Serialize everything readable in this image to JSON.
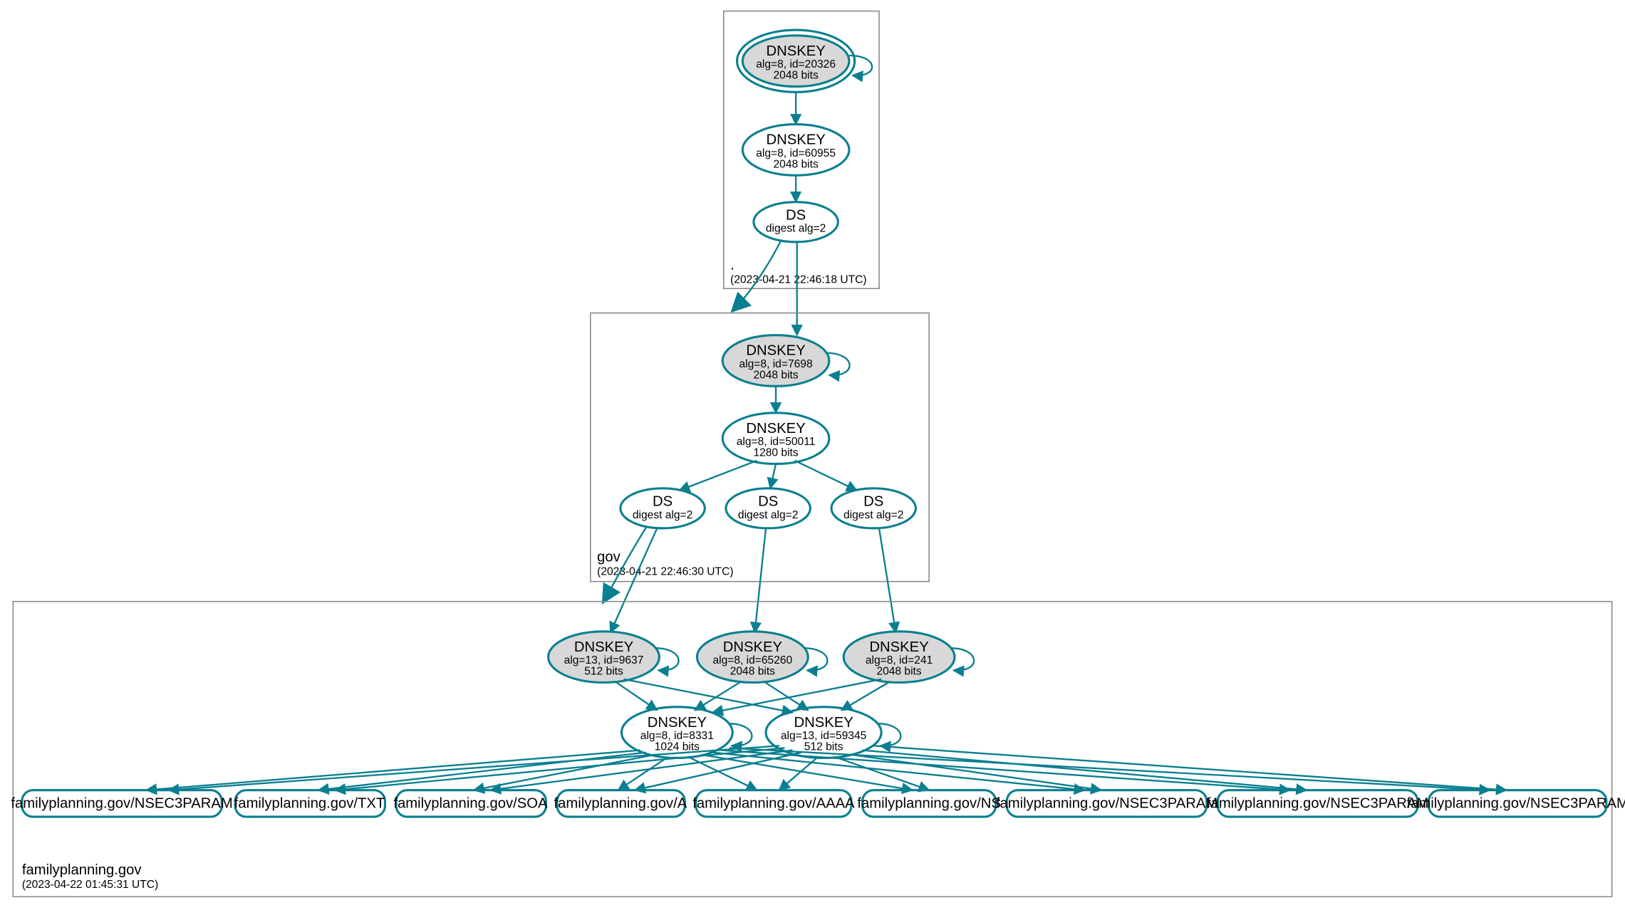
{
  "colors": {
    "stroke": "#0a7f8f",
    "ksk_fill": "#d8d8d8"
  },
  "zones": [
    {
      "id": "root",
      "label": ".",
      "timestamp": "(2023-04-21 22:46:18 UTC)"
    },
    {
      "id": "gov",
      "label": "gov",
      "timestamp": "(2023-04-21 22:46:30 UTC)"
    },
    {
      "id": "familyplanning",
      "label": "familyplanning.gov",
      "timestamp": "(2023-04-22 01:45:31 UTC)"
    }
  ],
  "nodes": {
    "root_ksk": {
      "t1": "DNSKEY",
      "t2": "alg=8, id=20326",
      "t3": "2048 bits"
    },
    "root_zsk": {
      "t1": "DNSKEY",
      "t2": "alg=8, id=60955",
      "t3": "2048 bits"
    },
    "root_ds": {
      "t1": "DS",
      "t2": "digest alg=2"
    },
    "gov_ksk": {
      "t1": "DNSKEY",
      "t2": "alg=8, id=7698",
      "t3": "2048 bits"
    },
    "gov_zsk": {
      "t1": "DNSKEY",
      "t2": "alg=8, id=50011",
      "t3": "1280 bits"
    },
    "gov_ds1": {
      "t1": "DS",
      "t2": "digest alg=2"
    },
    "gov_ds2": {
      "t1": "DS",
      "t2": "digest alg=2"
    },
    "gov_ds3": {
      "t1": "DS",
      "t2": "digest alg=2"
    },
    "fp_ksk1": {
      "t1": "DNSKEY",
      "t2": "alg=13, id=9637",
      "t3": "512 bits"
    },
    "fp_ksk2": {
      "t1": "DNSKEY",
      "t2": "alg=8, id=65260",
      "t3": "2048 bits"
    },
    "fp_ksk3": {
      "t1": "DNSKEY",
      "t2": "alg=8, id=241",
      "t3": "2048 bits"
    },
    "fp_zsk1": {
      "t1": "DNSKEY",
      "t2": "alg=8, id=8331",
      "t3": "1024 bits"
    },
    "fp_zsk2": {
      "t1": "DNSKEY",
      "t2": "alg=13, id=59345",
      "t3": "512 bits"
    },
    "rr1": {
      "t1": "familyplanning.gov/NSEC3PARAM"
    },
    "rr2": {
      "t1": "familyplanning.gov/TXT"
    },
    "rr3": {
      "t1": "familyplanning.gov/SOA"
    },
    "rr4": {
      "t1": "familyplanning.gov/A"
    },
    "rr5": {
      "t1": "familyplanning.gov/AAAA"
    },
    "rr6": {
      "t1": "familyplanning.gov/NS"
    },
    "rr7": {
      "t1": "familyplanning.gov/NSEC3PARAM"
    },
    "rr8": {
      "t1": "familyplanning.gov/NSEC3PARAM"
    },
    "rr9": {
      "t1": "familyplanning.gov/NSEC3PARAM"
    }
  }
}
